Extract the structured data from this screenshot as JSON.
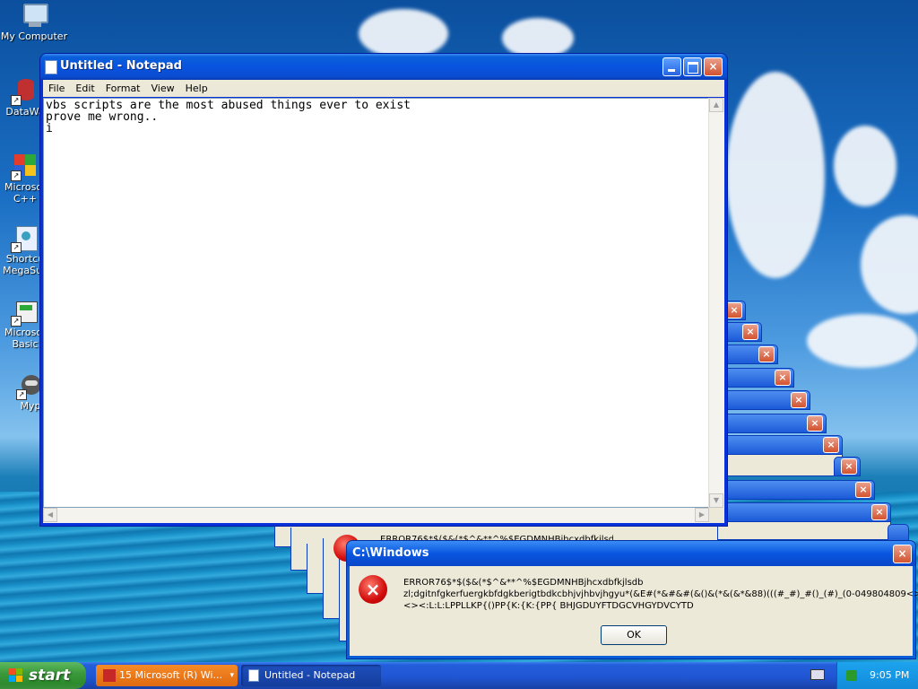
{
  "desktop": {
    "icons": [
      {
        "label": "My Computer"
      },
      {
        "label": "DataWa"
      },
      {
        "label": "Microsof\nC++"
      },
      {
        "label": "Shortcu\nMegaSus"
      },
      {
        "label": "Microsof\nBasic"
      },
      {
        "label": "Myp"
      }
    ]
  },
  "notepad": {
    "title": "Untitled - Notepad",
    "menu": [
      "File",
      "Edit",
      "Format",
      "View",
      "Help"
    ],
    "content": "vbs scripts are the most abused things ever to exist\nprove me wrong..\ni"
  },
  "stack_window_close": "×",
  "error_partial_text": "ERROR76$*$($&(*$^&**^%$EGDMNHBjhcxdbfkjlsdb",
  "error_dialog": {
    "title": "C:\\Windows",
    "message": "ERROR76$*$($&(*$^&**^%$EGDMNHBjhcxdbfkjlsdb\nzl;dgitnfgkerfuergkbfdgkberigtbdkcbhjvjhbvjhgyu*(&E#(*&#&#(&()&(*&(&*&88)(((#_#)_#()_(#)_(0-049804809<>\n<><:L:L:LPPLLKP{()PP{K:{K:{PP{ BHJGDUYFTDGCVHGYDVCYTD",
    "ok_label": "OK",
    "close": "×"
  },
  "taskbar": {
    "start_label": "start",
    "items": [
      {
        "label": "15 Microsoft (R) Wi..."
      },
      {
        "label": "Untitled - Notepad"
      }
    ],
    "clock": "9:05 PM"
  },
  "colors": {
    "titlebar": "#0854e0",
    "error_red": "#d10c0c",
    "taskbar": "#245edb",
    "start_green": "#3c9a3c"
  }
}
